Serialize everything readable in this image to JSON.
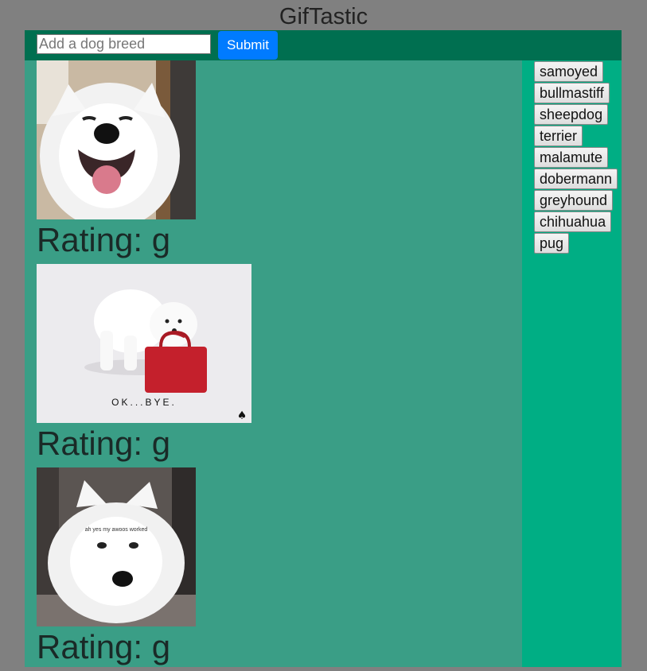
{
  "app": {
    "title": "GifTastic"
  },
  "search": {
    "placeholder": "Add a dog breed",
    "value": "",
    "submit_label": "Submit"
  },
  "breed_buttons": [
    "samoyed",
    "bullmastiff",
    "sheepdog",
    "terrier",
    "malamute",
    "dobermann",
    "greyhound",
    "chihuahua",
    "pug"
  ],
  "gifs": [
    {
      "rating_label": "Rating: g",
      "caption": ""
    },
    {
      "rating_label": "Rating: g",
      "caption": "OK...BYE."
    },
    {
      "rating_label": "Rating: g",
      "caption": "ah yes my awoos worked"
    }
  ],
  "colors": {
    "page_bg": "#808080",
    "header_bar": "#006f50",
    "results_bg": "#3a9e86",
    "sidebar_bg": "#00ae84",
    "submit_button": "#007bff"
  }
}
